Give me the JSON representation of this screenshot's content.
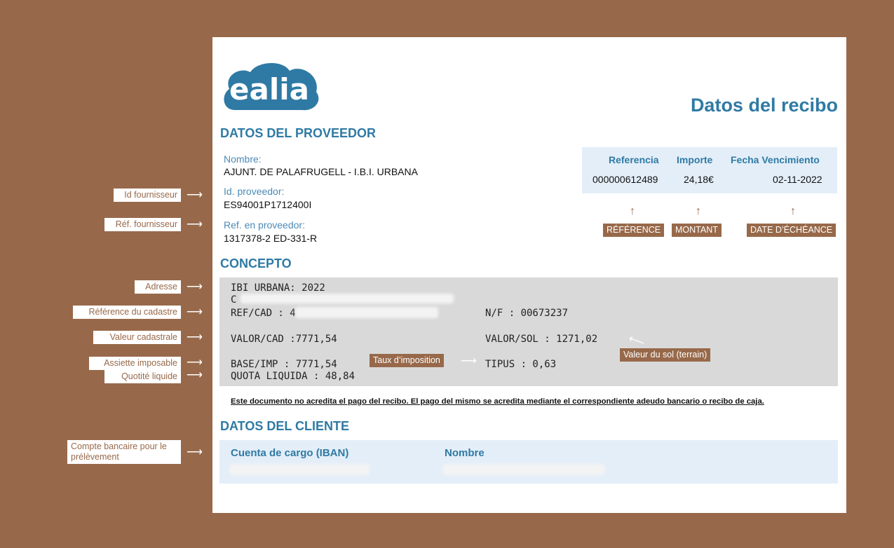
{
  "brand": {
    "name": "ealia",
    "color": "#2f7aa4"
  },
  "title": "Datos del recibo",
  "supplier": {
    "heading": "DATOS DEL PROVEEDOR",
    "name_label": "Nombre:",
    "name_value": "AJUNT. DE PALAFRUGELL - I.B.I. URBANA",
    "id_label": "Id. proveedor:",
    "id_value": "ES94001P1712400I",
    "ref_label": "Ref. en proveedor:",
    "ref_value": "1317378-2 ED-331-R"
  },
  "receipt": {
    "headers": [
      "Referencia",
      "Importe",
      "Fecha Vencimiento"
    ],
    "values": [
      "000000612489",
      "24,18€",
      "02-11-2022"
    ]
  },
  "concept": {
    "heading": "CONCEPTO",
    "line1": "IBI URBANA: 2022",
    "line2": "C",
    "refcad": "REF/CAD : 4",
    "nf": "N/F : 00673237",
    "valorcad": "VALOR/CAD :7771,54",
    "valorsol": "VALOR/SOL : 1271,02",
    "baseimp": "BASE/IMP : 7771,54",
    "tipus": "TIPUS : 0,63",
    "quota": "QUOTA LIQUIDA : 48,84"
  },
  "disclaimer": "Este documento no acredita el pago del recibo. El pago del mismo se acredita mediante el correspondiente adeudo bancario o recibo de caja.",
  "client": {
    "heading": "DATOS DEL CLIENTE",
    "col1": "Cuenta de cargo (IBAN)",
    "col2": "Nombre"
  },
  "annotations": {
    "supplier_id": "Id fournisseur",
    "supplier_ref": "Réf. fournisseur",
    "address": "Adresse",
    "cadastre_ref": "Référence du cadastre",
    "cadastral_value": "Valeur cadastrale",
    "tax_base": "Assiette imposable",
    "net_amount": "Quotité liquide",
    "tax_rate": "Taux d’imposition",
    "land_value": "Valeur du sol (terrain)",
    "reference": "RÉFÉRENCE",
    "amount": "MONTANT",
    "due_date": "DATE D’ÉCHÉANCE",
    "bank_account": "Compte bancaire pour le prélèvement"
  },
  "colors": {
    "background": "#97694a",
    "accent": "#2f7aa4",
    "panel_blue": "#e3eef8",
    "panel_grey": "#d9d9d9"
  }
}
